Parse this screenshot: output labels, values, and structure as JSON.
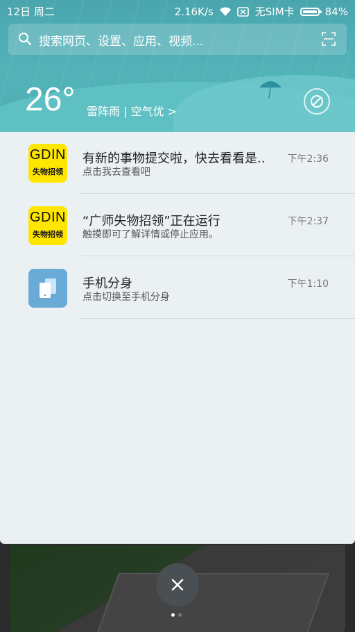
{
  "status_bar": {
    "date": "12日 周二",
    "speed": "2.16K/s",
    "sim": "无SIM卡",
    "battery": "84%",
    "battery_level": 0.84
  },
  "search": {
    "placeholder": "搜索网页、设置、应用、视频..."
  },
  "weather": {
    "temperature": "26°",
    "summary": "雷阵雨 | 空气优 >"
  },
  "colors": {
    "header": "#52b3b9",
    "panel": "#ebf1f3",
    "gdin_yellow": "#ffe600",
    "clone_blue": "#6aaad6"
  },
  "notifications": [
    {
      "app": "GDIN",
      "app_sub": "失物招领",
      "icon": "gdin-app-icon",
      "title": "有新的事物提交啦，快去看看是..",
      "subtitle": "点击我去查看吧",
      "time": "下午2:36"
    },
    {
      "app": "GDIN",
      "app_sub": "失物招领",
      "icon": "gdin-app-icon",
      "title": "“广师失物招领”正在运行",
      "subtitle": "触摸即可了解详情或停止应用。",
      "time": "下午2:37"
    },
    {
      "icon": "phone-clone-icon",
      "title": "手机分身",
      "subtitle": "点击切换至手机分身",
      "time": "下午1:10"
    }
  ]
}
